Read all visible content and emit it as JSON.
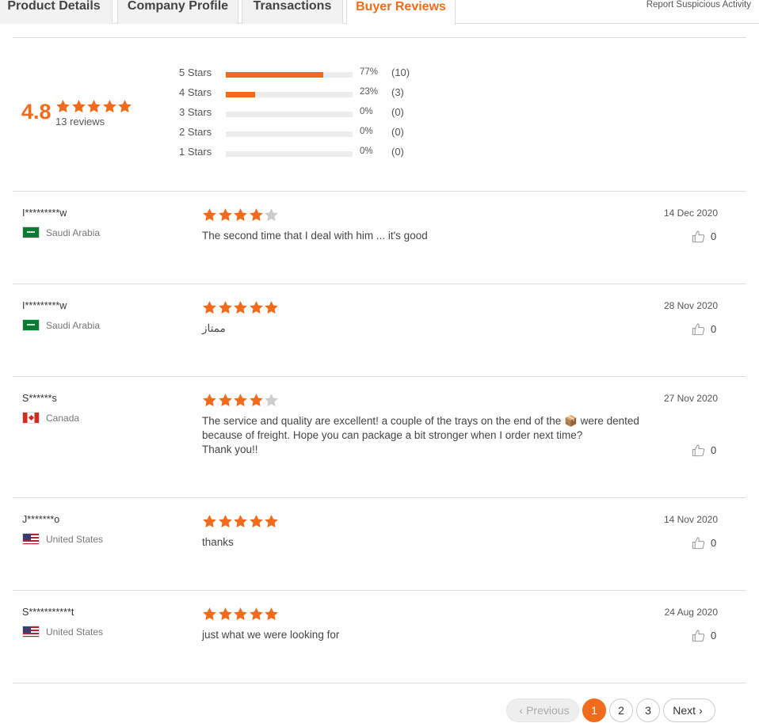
{
  "tabs": [
    {
      "label": "Product Details"
    },
    {
      "label": "Company Profile"
    },
    {
      "label": "Transactions"
    },
    {
      "label": "Buyer Reviews",
      "active": true
    }
  ],
  "report_link": "Report Suspicious Activity",
  "summary": {
    "rating": "4.8",
    "reviews_label": "13 reviews",
    "distribution": [
      {
        "label": "5 Stars",
        "percent": 77,
        "percent_label": "77%",
        "count": "(10)"
      },
      {
        "label": "4 Stars",
        "percent": 23,
        "percent_label": "23%",
        "count": "(3)"
      },
      {
        "label": "3 Stars",
        "percent": 0,
        "percent_label": "0%",
        "count": "(0)"
      },
      {
        "label": "2 Stars",
        "percent": 0,
        "percent_label": "0%",
        "count": "(0)"
      },
      {
        "label": "1 Stars",
        "percent": 0,
        "percent_label": "0%",
        "count": "(0)"
      }
    ]
  },
  "reviews": [
    {
      "reviewer": "I*********w",
      "country": "Saudi Arabia",
      "flag": "saudi-arabia-flag",
      "stars": 4,
      "comment": "The second time that I deal with him ... it's good",
      "date": "14 Dec 2020",
      "helpful": "0"
    },
    {
      "reviewer": "I*********w",
      "country": "Saudi Arabia",
      "flag": "saudi-arabia-flag",
      "stars": 5,
      "comment": "ممتاز",
      "date": "28 Nov 2020",
      "helpful": "0"
    },
    {
      "reviewer": "S******s",
      "country": "Canada",
      "flag": "canada-flag",
      "stars": 4,
      "comment": "The service and quality are excellent!  a couple of the trays on the end of the 📦 were dented because of freight.  Hope you can package a bit stronger when I order next time?\nThank you!!",
      "date": "27 Nov 2020",
      "helpful": "0"
    },
    {
      "reviewer": "J*******o",
      "country": "United States",
      "flag": "united-states-flag",
      "stars": 5,
      "comment": "thanks",
      "date": "14 Nov 2020",
      "helpful": "0"
    },
    {
      "reviewer": "S***********t",
      "country": "United States",
      "flag": "united-states-flag",
      "stars": 5,
      "comment": "just what we were looking for",
      "date": "24 Aug 2020",
      "helpful": "0"
    }
  ],
  "pagination": {
    "previous": "Previous",
    "pages": [
      "1",
      "2",
      "3"
    ],
    "current": "1",
    "next": "Next"
  },
  "colors": {
    "accent": "#f26b1d",
    "star_empty": "#cccccc"
  }
}
